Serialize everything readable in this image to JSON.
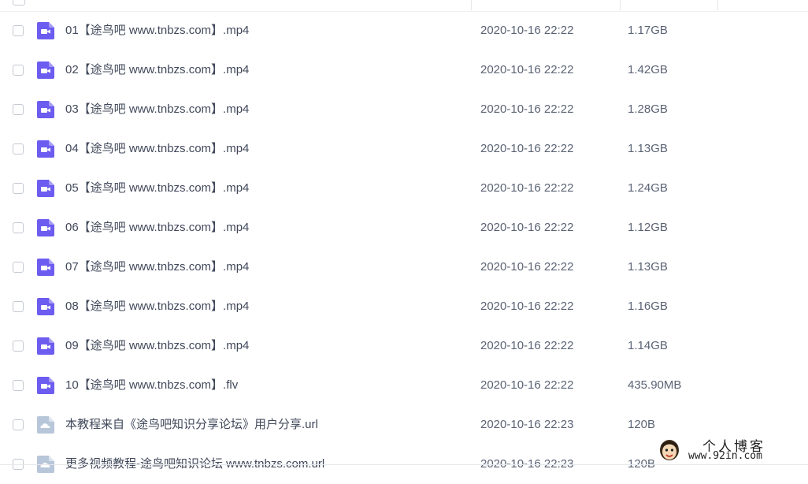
{
  "colors": {
    "video_icon": "#6d5cf0",
    "link_icon": "#b8c6d9",
    "text": "#40485a",
    "muted_text": "#5a6374"
  },
  "files": [
    {
      "name": "01【途鸟吧 www.tnbzs.com】.mp4",
      "date": "2020-10-16 22:22",
      "size": "1.17GB",
      "icon": "video-file-icon"
    },
    {
      "name": "02【途鸟吧 www.tnbzs.com】.mp4",
      "date": "2020-10-16 22:22",
      "size": "1.42GB",
      "icon": "video-file-icon"
    },
    {
      "name": "03【途鸟吧 www.tnbzs.com】.mp4",
      "date": "2020-10-16 22:22",
      "size": "1.28GB",
      "icon": "video-file-icon"
    },
    {
      "name": "04【途鸟吧 www.tnbzs.com】.mp4",
      "date": "2020-10-16 22:22",
      "size": "1.13GB",
      "icon": "video-file-icon"
    },
    {
      "name": "05【途鸟吧 www.tnbzs.com】.mp4",
      "date": "2020-10-16 22:22",
      "size": "1.24GB",
      "icon": "video-file-icon"
    },
    {
      "name": "06【途鸟吧 www.tnbzs.com】.mp4",
      "date": "2020-10-16 22:22",
      "size": "1.12GB",
      "icon": "video-file-icon"
    },
    {
      "name": "07【途鸟吧 www.tnbzs.com】.mp4",
      "date": "2020-10-16 22:22",
      "size": "1.13GB",
      "icon": "video-file-icon"
    },
    {
      "name": "08【途鸟吧 www.tnbzs.com】.mp4",
      "date": "2020-10-16 22:22",
      "size": "1.16GB",
      "icon": "video-file-icon"
    },
    {
      "name": "09【途鸟吧 www.tnbzs.com】.mp4",
      "date": "2020-10-16 22:22",
      "size": "1.14GB",
      "icon": "video-file-icon"
    },
    {
      "name": "10【途鸟吧 www.tnbzs.com】.flv",
      "date": "2020-10-16 22:22",
      "size": "435.90MB",
      "icon": "video-file-icon"
    },
    {
      "name": "本教程来自《途鸟吧知识分享论坛》用户分享.url",
      "date": "2020-10-16 22:23",
      "size": "120B",
      "icon": "link-file-icon"
    },
    {
      "name": "更多视频教程-途鸟吧知识论坛 www.tnbzs.com.url",
      "date": "2020-10-16 22:23",
      "size": "120B",
      "icon": "link-file-icon"
    }
  ],
  "watermark": {
    "title": "个人博客",
    "url": "www.92in.com"
  }
}
